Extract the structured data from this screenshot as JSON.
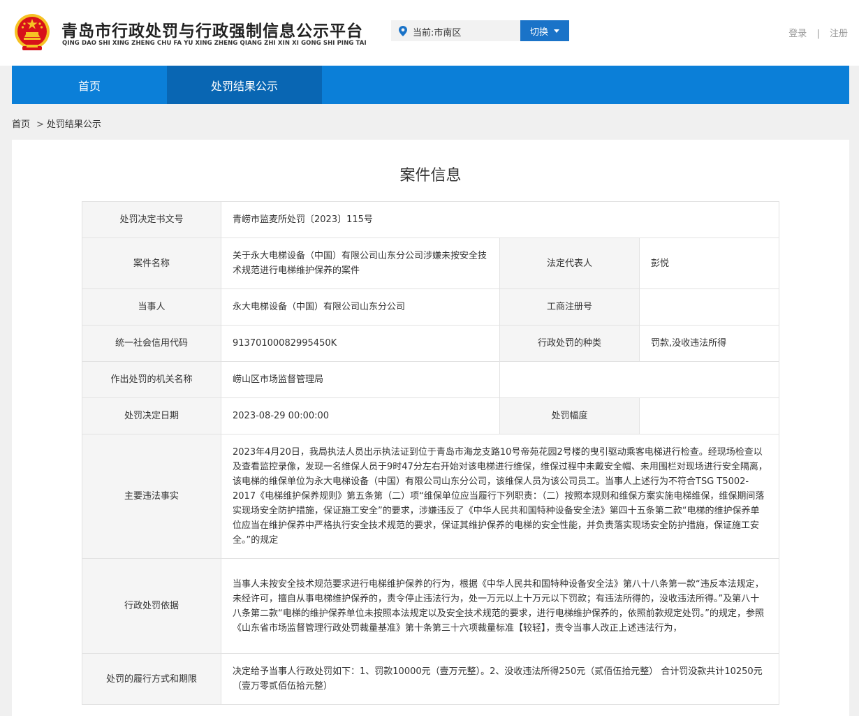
{
  "header": {
    "title": "青岛市行政处罚与行政强制信息公示平台",
    "pinyin": "QING DAO SHI XING ZHENG CHU FA YU XING ZHENG QIANG ZHI XIN XI GONG SHI PING TAI",
    "location_text": "当前:市南区",
    "switch_label": "切换",
    "login_label": "登录",
    "separator": "|",
    "register_label": "注册"
  },
  "nav": {
    "items": [
      {
        "label": "首页"
      },
      {
        "label": "处罚结果公示"
      }
    ]
  },
  "breadcrumb": {
    "home": "首页",
    "separator": ">",
    "current": "处罚结果公示"
  },
  "case": {
    "title": "案件信息",
    "labels": {
      "decision_no": "处罚决定书文号",
      "case_name": "案件名称",
      "legal_rep": "法定代表人",
      "party": "当事人",
      "biz_reg_no": "工商注册号",
      "credit_code": "统一社会信用代码",
      "penalty_type": "行政处罚的种类",
      "authority": "作出处罚的机关名称",
      "decision_date": "处罚决定日期",
      "penalty_range": "处罚幅度",
      "facts": "主要违法事实",
      "basis": "行政处罚依据",
      "execution": "处罚的履行方式和期限"
    },
    "values": {
      "decision_no": "青崂市监麦所处罚〔2023〕115号",
      "case_name": "关于永大电梯设备（中国）有限公司山东分公司涉嫌未按安全技术规范进行电梯维护保养的案件",
      "legal_rep": "彭悦",
      "party": "永大电梯设备（中国）有限公司山东分公司",
      "biz_reg_no": "",
      "credit_code": "91370100082995450K",
      "penalty_type": "罚款,没收违法所得",
      "authority": "崂山区市场监督管理局",
      "decision_date": "2023-08-29 00:00:00",
      "penalty_range": "",
      "facts": "2023年4月20日，我局执法人员出示执法证到位于青岛市海龙支路10号帝苑花园2号楼的曳引驱动乘客电梯进行检查。经现场检查以及查看监控录像，发现一名维保人员于9时47分左右开始对该电梯进行维保，维保过程中未戴安全帽、未用围栏对现场进行安全隔离，该电梯的维保单位为永大电梯设备（中国）有限公司山东分公司，该维保人员为该公司员工。当事人上述行为不符合TSG T5002-2017《电梯维护保养规则》第五条第（二）项“维保单位应当履行下列职责：（二）按照本规则和维保方案实施电梯维保，维保期间落实现场安全防护措施，保证施工安全”的要求，涉嫌违反了《中华人民共和国特种设备安全法》第四十五条第二款“电梯的维护保养单位应当在维护保养中严格执行安全技术规范的要求，保证其维护保养的电梯的安全性能，并负责落实现场安全防护措施，保证施工安全。”的规定",
      "basis": "当事人未按安全技术规范要求进行电梯维护保养的行为，根据《中华人民共和国特种设备安全法》第八十八条第一款“违反本法规定，未经许可，擅自从事电梯维护保养的，责令停止违法行为，处一万元以上十万元以下罚款；有违法所得的，没收违法所得。”及第八十八条第二款“电梯的维护保养单位未按照本法规定以及安全技术规范的要求，进行电梯维护保养的，依照前款规定处罚。”的规定，参照《山东省市场监督管理行政处罚裁量基准》第十条第三十六项裁量标准【较轻】，责令当事人改正上述违法行为，",
      "execution": "决定给予当事人行政处罚如下：1、罚款10000元（壹万元整）。2、没收违法所得250元（贰佰伍拾元整） 合计罚没款共计10250元（壹万零贰佰伍拾元整）"
    }
  },
  "colors": {
    "nav_blue": "#0b7fd8",
    "nav_active": "#0966b3",
    "button_blue": "#1a73c8",
    "emblem_red": "#d7111a",
    "emblem_gold": "#f6c224"
  },
  "icons": {
    "emblem": "national-emblem-icon",
    "location": "location-pin-icon",
    "caret": "caret-down-icon"
  }
}
